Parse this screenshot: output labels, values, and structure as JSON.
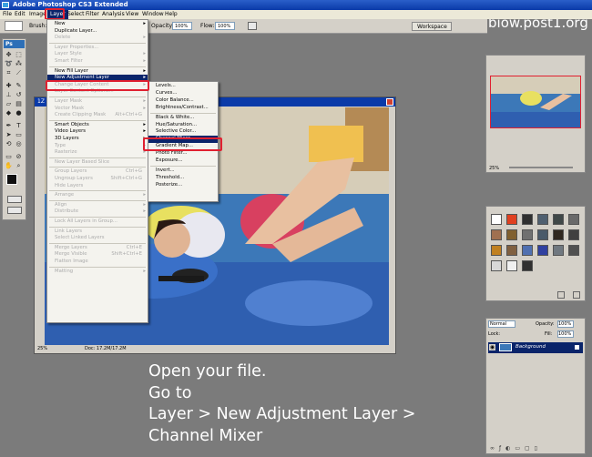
{
  "app_title": "Adobe Photoshop CS3 Extended",
  "watermark": "biow.post1.org",
  "menubar": [
    "File",
    "Edit",
    "Image",
    "Layer",
    "Select",
    "Filter",
    "Analysis",
    "View",
    "Window",
    "Help"
  ],
  "options": {
    "brush_label": "Brush:",
    "opacity_label": "Opacity:",
    "opacity_value": "100%",
    "flow_label": "Flow:",
    "flow_value": "100%",
    "workspace_label": "Workspace"
  },
  "toolbox_logo": "Ps",
  "doc": {
    "title_fragment": "1Z",
    "zoom": "25%",
    "doc_info": "Doc: 17.2M/17.2M"
  },
  "layer_menu": [
    {
      "label": "New",
      "arrow": true
    },
    {
      "label": "Duplicate Layer..."
    },
    {
      "label": "Delete",
      "dis": true,
      "arrow": true
    },
    {
      "sep": true
    },
    {
      "label": "Layer Properties...",
      "dis": true
    },
    {
      "label": "Layer Style",
      "dis": true,
      "arrow": true
    },
    {
      "label": "Smart Filter",
      "dis": true,
      "arrow": true
    },
    {
      "sep": true
    },
    {
      "label": "New Fill Layer",
      "arrow": true
    },
    {
      "label": "New Adjustment Layer",
      "arrow": true,
      "hl": true
    },
    {
      "label": "Change Layer Content",
      "dis": true,
      "arrow": true
    },
    {
      "label": "Layer Content Options...",
      "dis": true
    },
    {
      "sep": true
    },
    {
      "label": "Layer Mask",
      "dis": true,
      "arrow": true
    },
    {
      "label": "Vector Mask",
      "dis": true,
      "arrow": true
    },
    {
      "label": "Create Clipping Mask",
      "dis": true,
      "sc": "Alt+Ctrl+G"
    },
    {
      "sep": true
    },
    {
      "label": "Smart Objects",
      "arrow": true
    },
    {
      "label": "Video Layers",
      "arrow": true
    },
    {
      "label": "3D Layers",
      "arrow": true
    },
    {
      "label": "Type",
      "dis": true,
      "arrow": true
    },
    {
      "label": "Rasterize",
      "dis": true,
      "arrow": true
    },
    {
      "sep": true
    },
    {
      "label": "New Layer Based Slice",
      "dis": true
    },
    {
      "sep": true
    },
    {
      "label": "Group Layers",
      "dis": true,
      "sc": "Ctrl+G"
    },
    {
      "label": "Ungroup Layers",
      "dis": true,
      "sc": "Shift+Ctrl+G"
    },
    {
      "label": "Hide Layers",
      "dis": true
    },
    {
      "sep": true
    },
    {
      "label": "Arrange",
      "dis": true,
      "arrow": true
    },
    {
      "sep": true
    },
    {
      "label": "Align",
      "dis": true,
      "arrow": true
    },
    {
      "label": "Distribute",
      "dis": true,
      "arrow": true
    },
    {
      "sep": true
    },
    {
      "label": "Lock All Layers in Group...",
      "dis": true
    },
    {
      "sep": true
    },
    {
      "label": "Link Layers",
      "dis": true
    },
    {
      "label": "Select Linked Layers",
      "dis": true
    },
    {
      "sep": true
    },
    {
      "label": "Merge Layers",
      "dis": true,
      "sc": "Ctrl+E"
    },
    {
      "label": "Merge Visible",
      "dis": true,
      "sc": "Shift+Ctrl+E"
    },
    {
      "label": "Flatten Image",
      "dis": true
    },
    {
      "sep": true
    },
    {
      "label": "Matting",
      "dis": true,
      "arrow": true
    }
  ],
  "adj_menu": [
    {
      "label": "Levels..."
    },
    {
      "label": "Curves..."
    },
    {
      "label": "Color Balance..."
    },
    {
      "label": "Brightness/Contrast..."
    },
    {
      "sep": true
    },
    {
      "label": "Black & White..."
    },
    {
      "label": "Hue/Saturation..."
    },
    {
      "label": "Selective Color..."
    },
    {
      "label": "Channel Mixer...",
      "hl": true
    },
    {
      "label": "Gradient Map..."
    },
    {
      "label": "Photo Filter..."
    },
    {
      "label": "Exposure..."
    },
    {
      "sep": true
    },
    {
      "label": "Invert..."
    },
    {
      "label": "Threshold..."
    },
    {
      "label": "Posterize..."
    }
  ],
  "nav": {
    "zoom": "25%"
  },
  "layers": {
    "mode": "Normal",
    "opacity_label": "Opacity:",
    "opacity_value": "100%",
    "lock_label": "Lock:",
    "fill_label": "Fill:",
    "fill_value": "100%",
    "layer_name": "Background"
  },
  "caption": [
    "Open your file.",
    "Go to",
    "Layer > New Adjustment Layer >",
    "Channel Mixer"
  ]
}
